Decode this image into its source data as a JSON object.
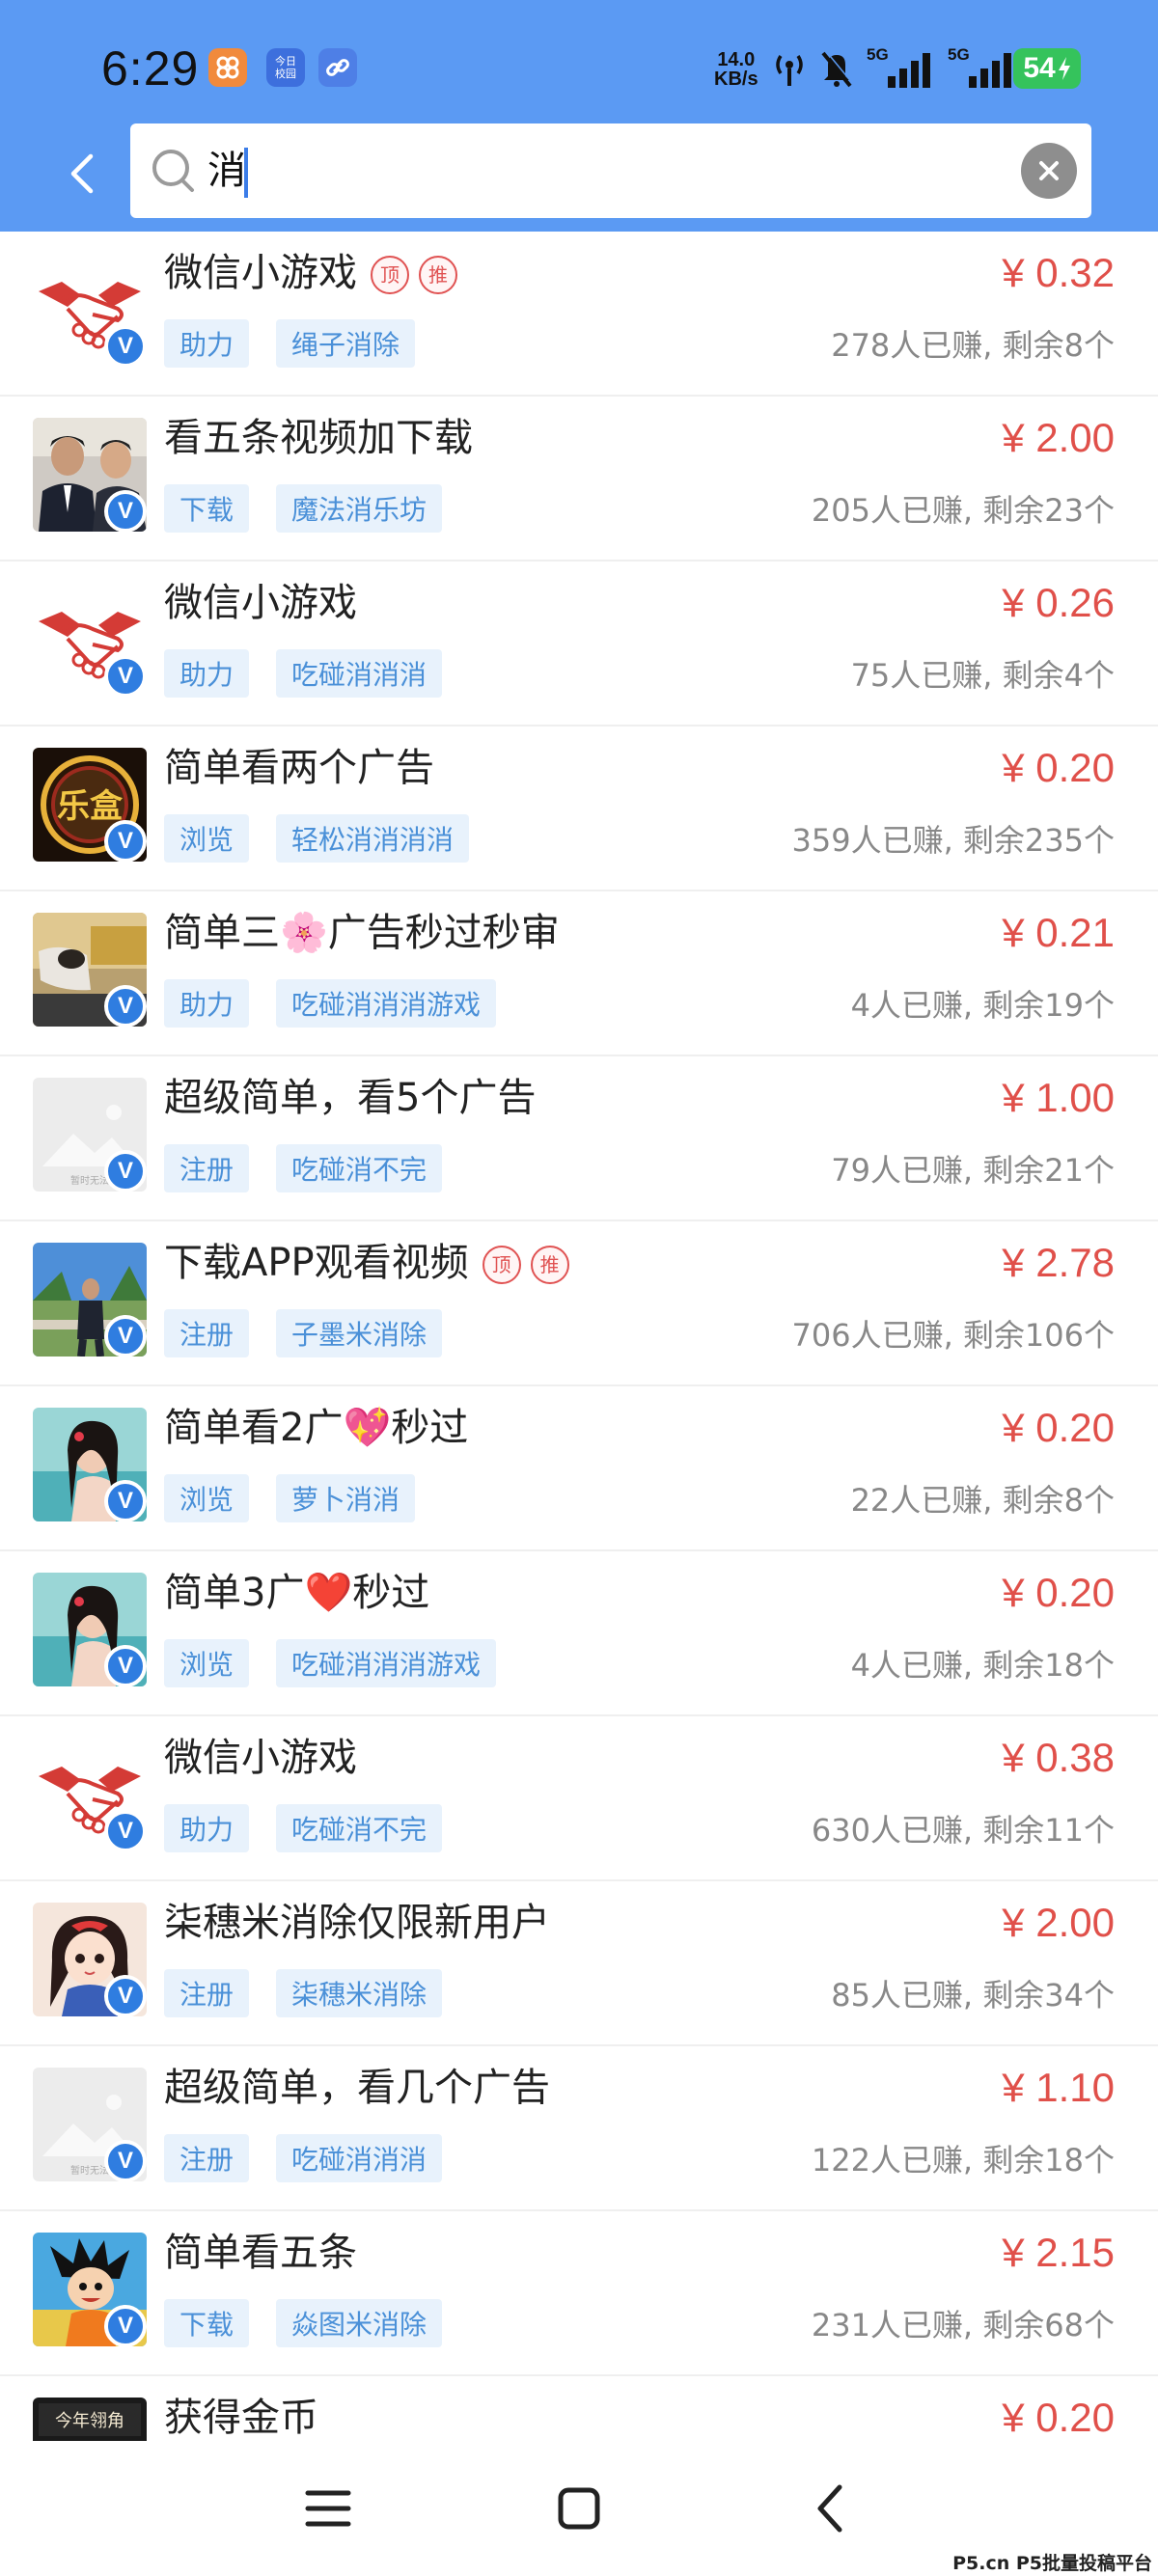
{
  "status_bar": {
    "time": "6:29",
    "net_speed_value": "14.0",
    "net_speed_unit": "KB/s",
    "news_icon_text": "今日\n校园",
    "battery_level": "54",
    "signal_1": "5G",
    "signal_2": "5G"
  },
  "search": {
    "query": "消"
  },
  "tasks": [
    {
      "title": "微信小游戏",
      "badges": [
        "顶",
        "推"
      ],
      "price": "¥ 0.32",
      "tags": [
        "助力",
        "绳子消除"
      ],
      "stats": "278人已赚, 剩余8个",
      "thumb": "handshake-icon"
    },
    {
      "title": "看五条视频加下载",
      "badges": [],
      "price": "¥ 2.00",
      "tags": [
        "下载",
        "魔法消乐坊"
      ],
      "stats": "205人已赚, 剩余23个",
      "thumb": "photo-men"
    },
    {
      "title": "微信小游戏",
      "badges": [],
      "price": "¥ 0.26",
      "tags": [
        "助力",
        "吃碰消消消"
      ],
      "stats": "75人已赚, 剩余4个",
      "thumb": "handshake-icon"
    },
    {
      "title": "简单看两个广告",
      "badges": [],
      "price": "¥ 0.20",
      "tags": [
        "浏览",
        "轻松消消消消"
      ],
      "stats": "359人已赚, 剩余235个",
      "thumb": "lehe-logo"
    },
    {
      "title": "简单三🌸广告秒过秒审",
      "badges": [],
      "price": "¥ 0.21",
      "tags": [
        "助力",
        "吃碰消消消游戏"
      ],
      "stats": "4人已赚, 剩余19个",
      "thumb": "photo-sleeping"
    },
    {
      "title": "超级简单，看5个广告",
      "badges": [],
      "price": "¥ 1.00",
      "tags": [
        "注册",
        "吃碰消不完"
      ],
      "stats": "79人已赚, 剩余21个",
      "thumb": "image-placeholder"
    },
    {
      "title": "下载APP观看视频",
      "badges": [
        "顶",
        "推"
      ],
      "price": "¥ 2.78",
      "tags": [
        "注册",
        "子墨米消除"
      ],
      "stats": "706人已赚, 剩余106个",
      "thumb": "photo-man-outdoor"
    },
    {
      "title": "简单看2广💖秒过",
      "badges": [],
      "price": "¥ 0.20",
      "tags": [
        "浏览",
        "萝卜消消"
      ],
      "stats": "22人已赚, 剩余8个",
      "thumb": "photo-girl-beach"
    },
    {
      "title": "简单3广❤️秒过",
      "badges": [],
      "price": "¥ 0.20",
      "tags": [
        "浏览",
        "吃碰消消消游戏"
      ],
      "stats": "4人已赚, 剩余18个",
      "thumb": "photo-girl-beach"
    },
    {
      "title": "微信小游戏",
      "badges": [],
      "price": "¥ 0.38",
      "tags": [
        "助力",
        "吃碰消不完"
      ],
      "stats": "630人已赚, 剩余11个",
      "thumb": "handshake-icon"
    },
    {
      "title": "柒穗米消除仅限新用户",
      "badges": [],
      "price": "¥ 2.00",
      "tags": [
        "注册",
        "柒穗米消除"
      ],
      "stats": "85人已赚, 剩余34个",
      "thumb": "cartoon-girl"
    },
    {
      "title": "超级简单，看几个广告",
      "badges": [],
      "price": "¥ 1.10",
      "tags": [
        "注册",
        "吃碰消消消"
      ],
      "stats": "122人已赚, 剩余18个",
      "thumb": "image-placeholder"
    },
    {
      "title": "简单看五条",
      "badges": [],
      "price": "¥ 2.15",
      "tags": [
        "下载",
        "焱图米消除"
      ],
      "stats": "231人已赚, 剩余68个",
      "thumb": "cartoon-boy"
    },
    {
      "title": "获得金币",
      "badges": [],
      "price": "¥ 0.20",
      "tags": [],
      "stats": "",
      "thumb": "calligraphy"
    }
  ],
  "placeholder_text": "暂时无法",
  "verified_mark": "V",
  "thumb_logo_text": "乐盒",
  "calligraphy_text": "今年翎角",
  "watermark": "P5.cn P5批量投稿平台",
  "colors": {
    "header_bg": "#5b9af3",
    "price": "#e0504a",
    "tag_bg": "#e8f2fc",
    "tag_text": "#4a90d8",
    "verified": "#2f7de0"
  }
}
